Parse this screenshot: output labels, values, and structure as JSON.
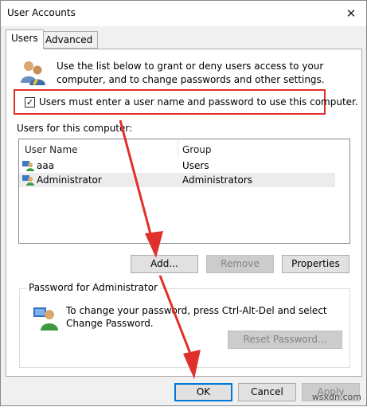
{
  "window": {
    "title": "User Accounts",
    "close_glyph": "✕"
  },
  "tabs": [
    {
      "label": "Users",
      "active": true
    },
    {
      "label": "Advanced",
      "active": false
    }
  ],
  "users_tab": {
    "description": "Use the list below to grant or deny users access to your computer, and to change passwords and other settings.",
    "require_login": {
      "label": "Users must enter a user name and password to use this computer.",
      "checked": true,
      "check_glyph": "✓"
    },
    "users_label": "Users for this computer:",
    "columns": [
      "User Name",
      "Group"
    ],
    "rows": [
      {
        "name": "aaa",
        "group": "Users",
        "selected": false
      },
      {
        "name": "Administrator",
        "group": "Administrators",
        "selected": true
      }
    ],
    "buttons": {
      "add": "Add...",
      "remove": "Remove",
      "properties": "Properties"
    },
    "password_group": {
      "title": "Password for Administrator",
      "text": "To change your password, press Ctrl-Alt-Del and select Change Password.",
      "reset_button": "Reset Password..."
    }
  },
  "dialog_buttons": {
    "ok": "OK",
    "cancel": "Cancel",
    "apply": "Apply"
  },
  "icons": {
    "users": "users-icon",
    "user": "user-icon",
    "admin": "admin-user-icon"
  },
  "colors": {
    "annotation": "#e0302b",
    "accent": "#0078d7",
    "selection": "#ececec"
  },
  "watermark": "wsxdn.com"
}
